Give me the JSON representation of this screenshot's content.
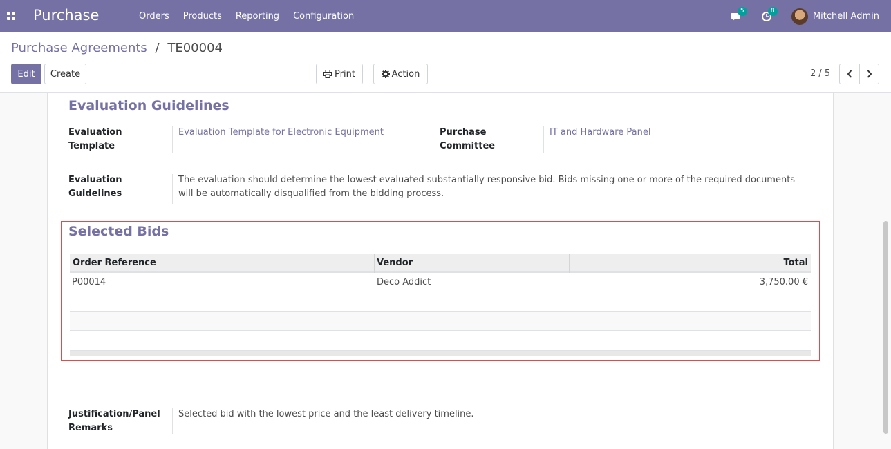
{
  "app": {
    "name": "Purchase"
  },
  "menu": [
    {
      "label": "Orders"
    },
    {
      "label": "Products"
    },
    {
      "label": "Reporting"
    },
    {
      "label": "Configuration"
    }
  ],
  "systray": {
    "messages_count": "5",
    "activities_count": "8",
    "user_name": "Mitchell Admin"
  },
  "breadcrumb": {
    "parent": "Purchase Agreements",
    "separator": "/",
    "current": "TE00004"
  },
  "toolbar": {
    "edit_label": "Edit",
    "create_label": "Create",
    "print_label": "Print",
    "action_label": "Action"
  },
  "pager": {
    "value": "2 / 5"
  },
  "evaluation": {
    "title": "Evaluation Guidelines",
    "template_label_1": "Evaluation",
    "template_label_2": "Template",
    "template_value": "Evaluation Template for Electronic Equipment",
    "committee_label_1": "Purchase",
    "committee_label_2": "Committee",
    "committee_value": "IT and Hardware Panel",
    "guidelines_label_1": "Evaluation",
    "guidelines_label_2": "Guidelines",
    "guidelines_line_1": "The evaluation should determine the lowest evaluated substantially responsive bid. Bids missing one or more of the required documents",
    "guidelines_line_2": "will be automatically disqualified from the bidding process."
  },
  "selected_bids": {
    "title": "Selected Bids",
    "columns": [
      "Order Reference",
      "Vendor",
      "Total"
    ],
    "rows": [
      {
        "order_reference": "P00014",
        "vendor": "Deco Addict",
        "total": "3,750.00 €"
      }
    ]
  },
  "justification": {
    "label_1": "Justification/Panel",
    "label_2": "Remarks",
    "value": "Selected bid with the lowest price and the least delivery timeline."
  },
  "colors": {
    "brand": "#7571a4",
    "badge": "#00a09d",
    "highlight": "#e04b4b"
  }
}
